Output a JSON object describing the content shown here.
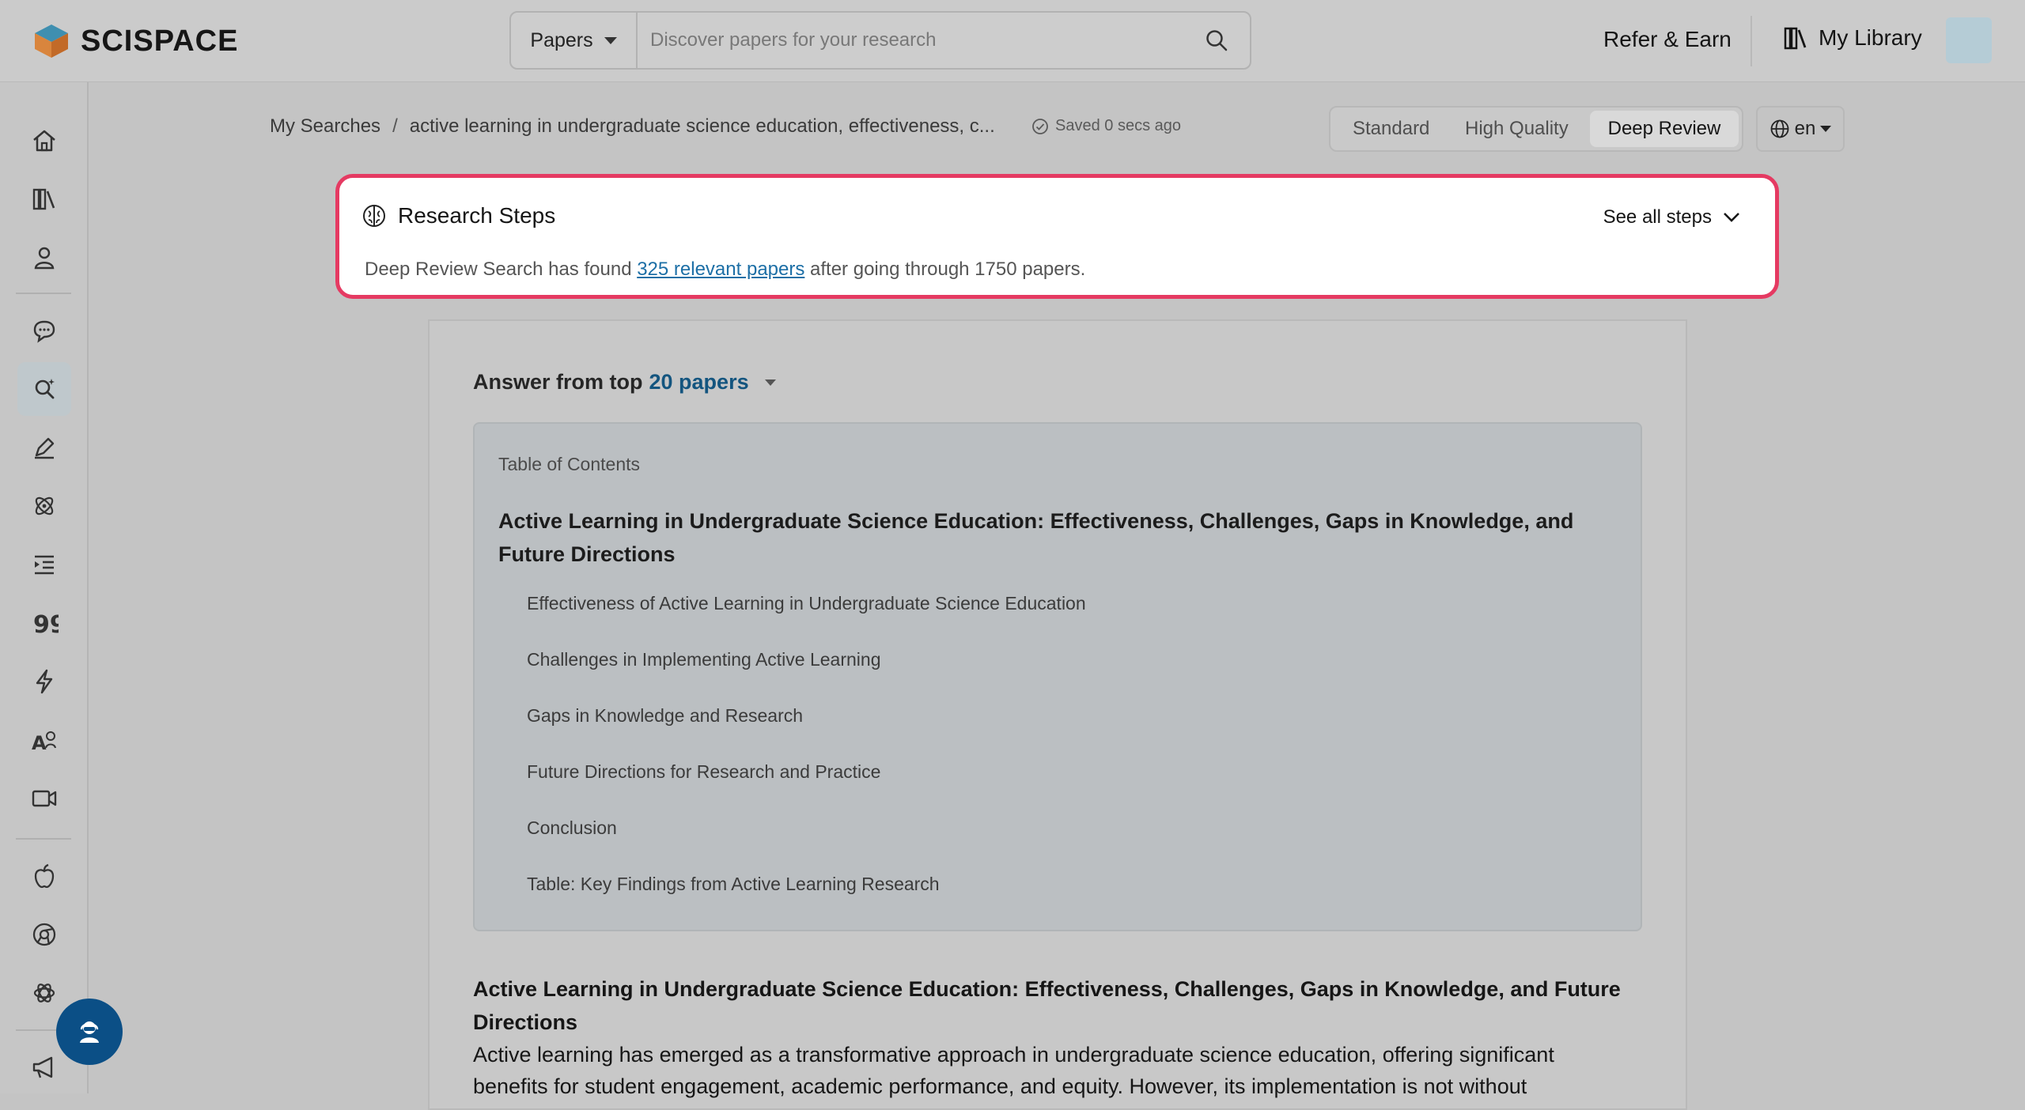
{
  "header": {
    "brand": "SCISPACE",
    "search_category": "Papers",
    "search_placeholder": "Discover papers for your research",
    "refer": "Refer & Earn",
    "library": "My Library"
  },
  "sidebar": {
    "icons": [
      "home-icon",
      "library-icon",
      "user-icon",
      "chat-icon",
      "search-ai-icon",
      "pen-icon",
      "atom-icon",
      "outline-icon",
      "quote-icon",
      "lightning-icon",
      "ai-writer-icon",
      "video-icon",
      "apple-icon",
      "chrome-icon",
      "openai-icon",
      "megaphone-icon"
    ]
  },
  "breadcrumb": {
    "root": "My Searches",
    "separator": "/",
    "current": "active learning in undergraduate science education, effectiveness, c..."
  },
  "saved_status": "Saved 0 secs ago",
  "modes": {
    "standard": "Standard",
    "high_quality": "High Quality",
    "deep_review": "Deep Review",
    "active": "Deep Review"
  },
  "language": "en",
  "research_steps": {
    "title": "Research Steps",
    "see_all": "See all steps",
    "text_before": "Deep Review Search has found ",
    "link": "325 relevant papers",
    "text_after": " after going through 1750 papers."
  },
  "answer": {
    "prefix": "Answer from top ",
    "papers": "20 papers"
  },
  "toc": {
    "label": "Table of Contents",
    "title": "Active Learning in Undergraduate Science Education: Effectiveness, Challenges, Gaps in Knowledge, and Future Directions",
    "items": [
      "Effectiveness of Active Learning in Undergraduate Science Education",
      "Challenges in Implementing Active Learning",
      "Gaps in Knowledge and Research",
      "Future Directions for Research and Practice",
      "Conclusion",
      "Table: Key Findings from Active Learning Research"
    ]
  },
  "body": {
    "heading": "Active Learning in Undergraduate Science Education: Effectiveness, Challenges, Gaps in Knowledge, and Future Directions",
    "paragraph": "Active learning has emerged as a transformative approach in undergraduate science education, offering significant benefits for student engagement, academic performance, and equity. However, its implementation is not without"
  },
  "colors": {
    "highlight": "#e53a62",
    "link": "#1d6fa6",
    "brand_blue": "#14557f",
    "fab": "#0b4f86"
  }
}
